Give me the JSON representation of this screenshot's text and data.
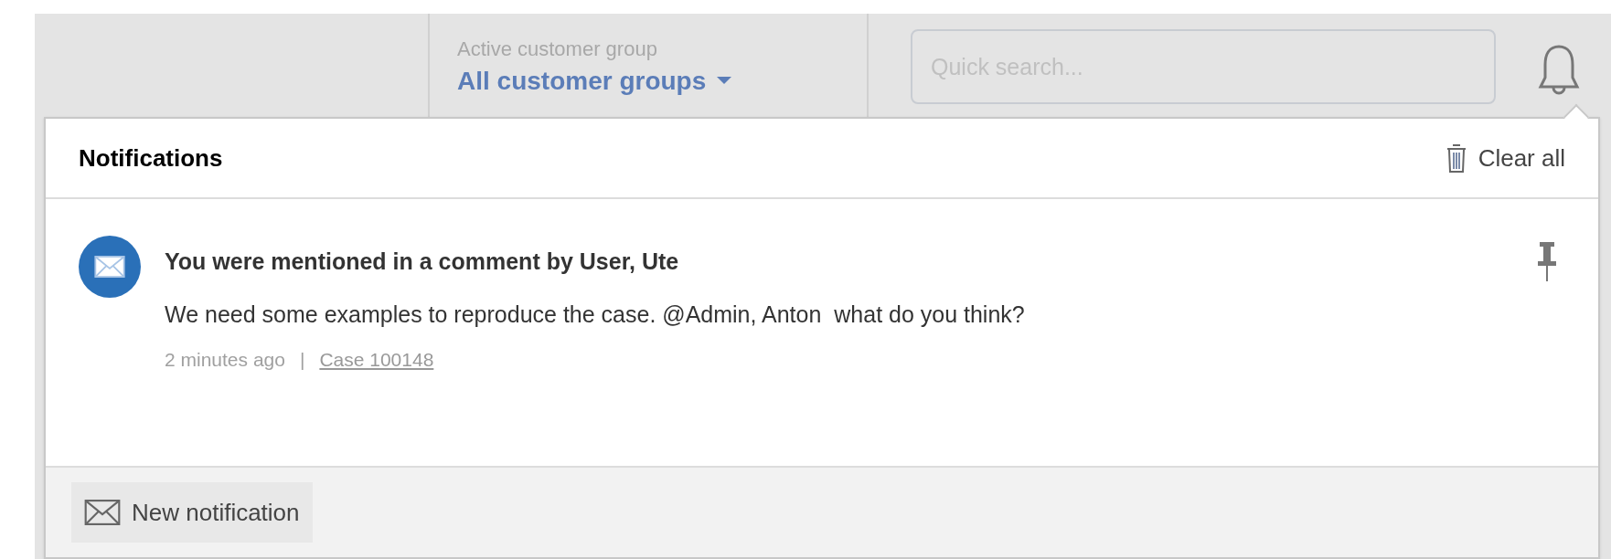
{
  "header": {
    "customer_group": {
      "label": "Active customer group",
      "value": "All customer groups"
    },
    "search": {
      "placeholder": "Quick search..."
    }
  },
  "notifications_panel": {
    "title": "Notifications",
    "clear_all": "Clear all",
    "items": [
      {
        "title": "You were mentioned in a comment by User, Ute",
        "message": "We need some examples to reproduce the case. @Admin, Anton  what do you think?",
        "time": "2 minutes ago",
        "separator": "|",
        "link": "Case 100148"
      }
    ],
    "footer_button": "New notification"
  }
}
